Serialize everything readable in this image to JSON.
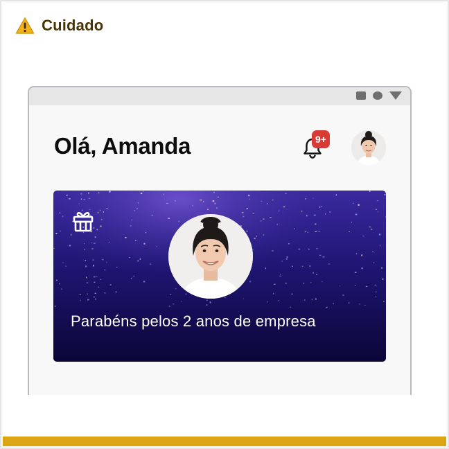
{
  "callout": {
    "title": "Cuidado",
    "icon": "warning-triangle-icon",
    "accent_color": "#dba514",
    "icon_color": "#f2b21a"
  },
  "window": {
    "controls": [
      "minimize-square-icon",
      "maximize-circle-icon",
      "close-triangle-icon"
    ]
  },
  "header": {
    "greeting": "Olá, Amanda",
    "notifications": {
      "icon": "bell-icon",
      "badge": "9+",
      "badge_color": "#d93a33"
    },
    "avatar": "user-avatar"
  },
  "card": {
    "icon": "gift-icon",
    "avatar": "user-avatar",
    "message": "Parabéns pelos 2 anos de empresa",
    "background_color": "#1a0f5c"
  }
}
